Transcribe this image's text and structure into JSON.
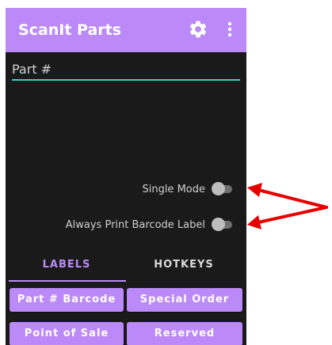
{
  "app": {
    "title": "ScanIt Parts",
    "accent_color": "#bb8af8",
    "background_color": "#1a1a1a",
    "input_underline_color": "#33d1c6"
  },
  "toolbar": {
    "settings_icon": "gear-icon",
    "overflow_icon": "more-vert-icon"
  },
  "part_input": {
    "placeholder": "Part #",
    "value": ""
  },
  "options": {
    "single_mode_label": "Single Mode",
    "single_mode_on": false,
    "always_print_label": "Always Print Barcode Label",
    "always_print_on": false
  },
  "tabs": [
    {
      "label": "LABELS",
      "selected": true
    },
    {
      "label": "HOTKEYS",
      "selected": false
    }
  ],
  "buttons": {
    "part_barcode": "Part # Barcode",
    "special_order": "Special Order",
    "point_of_sale": "Point of Sale",
    "reserved": "Reserved"
  },
  "annotation": {
    "arrow_color": "#e60000"
  }
}
